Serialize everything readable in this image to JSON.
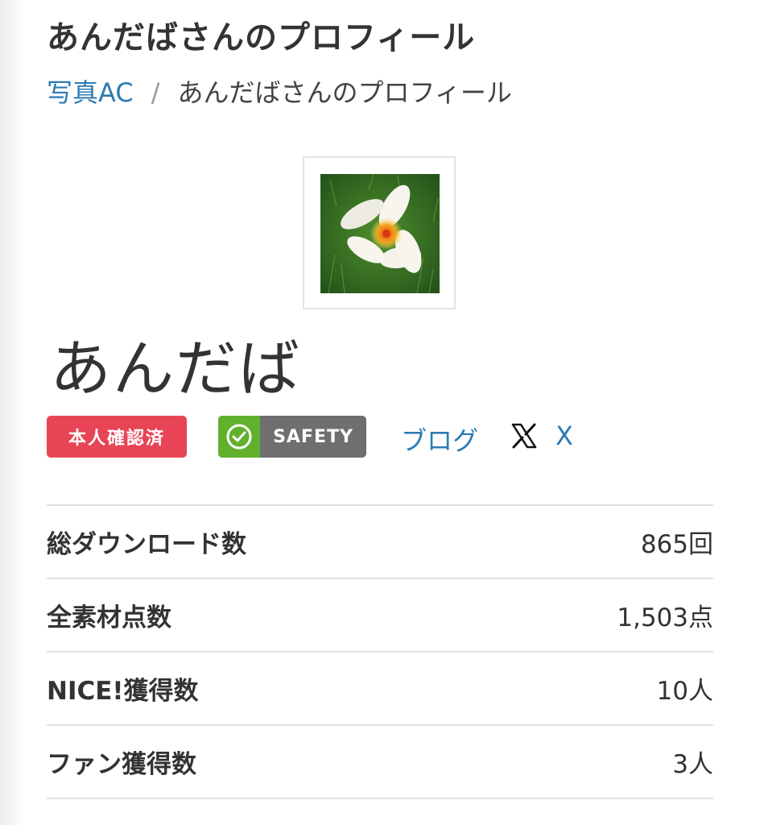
{
  "header": {
    "title": "あんだばさんのプロフィール"
  },
  "breadcrumb": {
    "home": "写真AC",
    "separator": "/",
    "current": "あんだばさんのプロフィール"
  },
  "profile": {
    "avatar_icon": "flower-photo",
    "name": "あんだば"
  },
  "badges": {
    "verified": "本人確認済",
    "safety": "SAFETY",
    "blog": "ブログ",
    "x": "X"
  },
  "stats": [
    {
      "label": "総ダウンロード数",
      "value": "865回"
    },
    {
      "label": "全素材点数",
      "value": "1,503点"
    },
    {
      "label": "NICE!獲得数",
      "value": "10人"
    },
    {
      "label": "ファン獲得数",
      "value": "3人"
    }
  ],
  "colors": {
    "link": "#2d7bb3",
    "verified_badge": "#e74556",
    "safety_green": "#62b12c",
    "safety_gray": "#6f6f6f"
  }
}
